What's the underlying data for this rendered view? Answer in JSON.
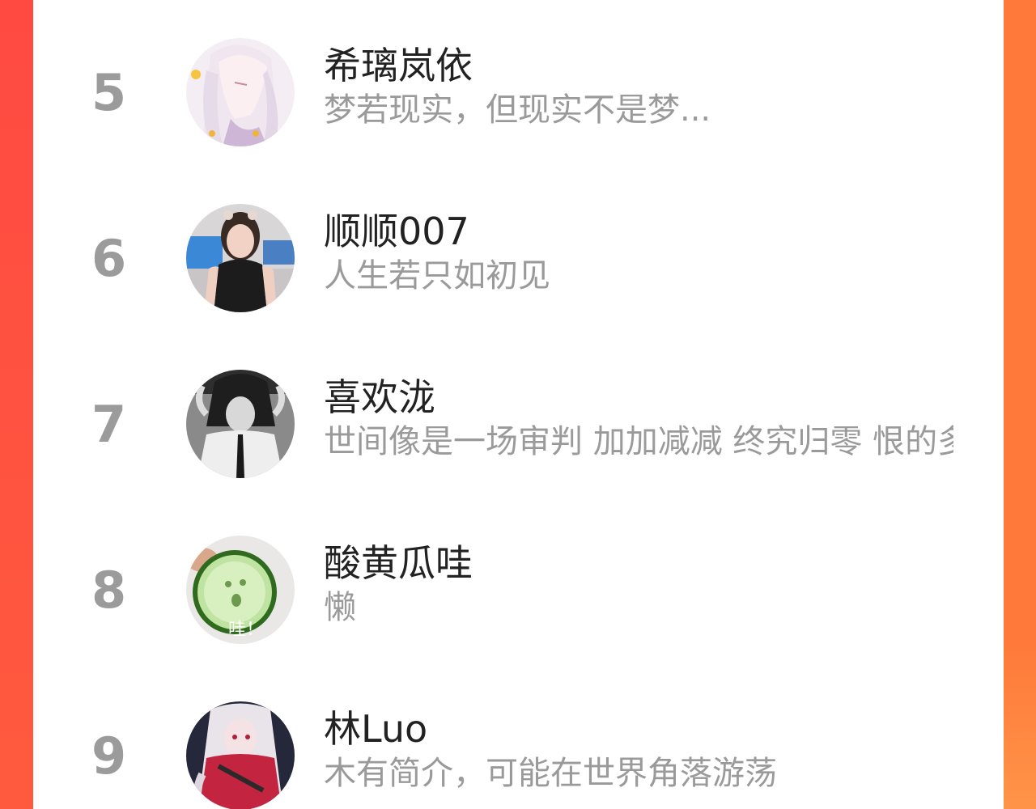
{
  "colors": {
    "accent_left": "#ff4a3d",
    "accent_right": "#ff7a3a",
    "card_bg": "#ffffff",
    "rank_color": "#9b9b9b",
    "name_color": "#222222",
    "bio_color": "#9a9a9a"
  },
  "users": [
    {
      "rank": "5",
      "name": "希璃岚依",
      "bio": "梦若现实，但现实不是梦...",
      "avatar_icon": "anime-girl-avatar"
    },
    {
      "rank": "6",
      "name": "顺顺007",
      "bio": "人生若只如初见",
      "avatar_icon": "woman-photo-avatar"
    },
    {
      "rank": "7",
      "name": "喜欢泷",
      "bio": "世间像是一场审判 加加减减 终究归零 恨的多",
      "avatar_icon": "grayscale-anime-avatar"
    },
    {
      "rank": "8",
      "name": "酸黄瓜哇",
      "bio": "懒",
      "avatar_icon": "cucumber-slice-avatar",
      "avatar_caption": "哇！"
    },
    {
      "rank": "9",
      "name": "林Luo",
      "bio": "木有简介，可能在世界角落游荡",
      "avatar_icon": "anime-warrior-avatar"
    }
  ]
}
